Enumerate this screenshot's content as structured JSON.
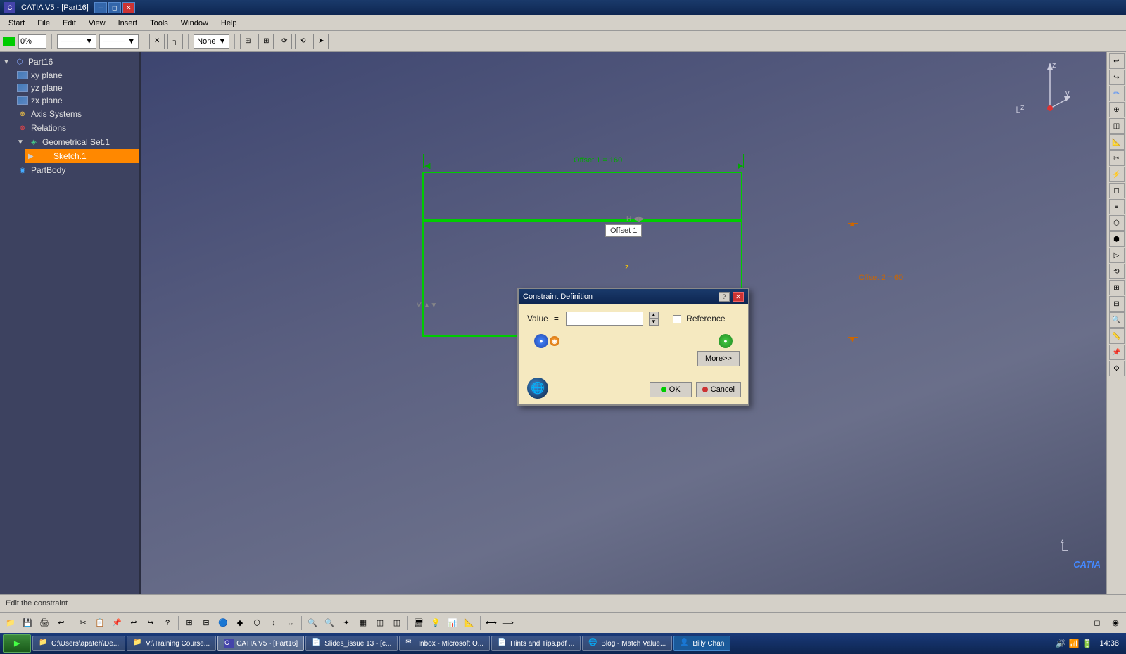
{
  "title_bar": {
    "title": "CATIA V5 - [Part16]",
    "icon": "C",
    "buttons": [
      "minimize",
      "restore",
      "close"
    ]
  },
  "menu_bar": {
    "items": [
      "Start",
      "File",
      "Edit",
      "View",
      "Insert",
      "Tools",
      "Window",
      "Help"
    ]
  },
  "toolbar": {
    "color_btn": "■",
    "percent": "0%",
    "line_style": "—",
    "line_weight": "—",
    "none_label": "None"
  },
  "left_panel": {
    "title": "Part16",
    "items": [
      {
        "id": "part16",
        "label": "Part16",
        "icon": "part",
        "indent": 0
      },
      {
        "id": "xy-plane",
        "label": "xy plane",
        "icon": "plane",
        "indent": 1
      },
      {
        "id": "yz-plane",
        "label": "yz plane",
        "icon": "plane",
        "indent": 1
      },
      {
        "id": "zx-plane",
        "label": "zx plane",
        "icon": "plane",
        "indent": 1
      },
      {
        "id": "axis-systems",
        "label": "Axis Systems",
        "icon": "axis",
        "indent": 1
      },
      {
        "id": "relations",
        "label": "Relations",
        "icon": "relations",
        "indent": 1
      },
      {
        "id": "geometrical-set",
        "label": "Geometrical Set.1",
        "icon": "geoset",
        "indent": 1,
        "underline": true
      },
      {
        "id": "sketch1",
        "label": "Sketch.1",
        "icon": "sketch",
        "indent": 2,
        "selected": true
      },
      {
        "id": "partbody",
        "label": "PartBody",
        "icon": "partbody",
        "indent": 1
      }
    ]
  },
  "canvas": {
    "offset1_label": "Offset 1 = 160",
    "offset1_box": "Offset 1",
    "offset2_label": "Offset.2 = 60",
    "axis_z": "z",
    "axis_y": "y",
    "axis_corner_z": "z",
    "axis_corner": "└"
  },
  "dialog": {
    "title": "Constraint Definition",
    "value_label": "Value",
    "value_input": "",
    "reference_label": "Reference",
    "more_btn": "More>>",
    "ok_btn": "OK",
    "cancel_btn": "Cancel"
  },
  "status_bar": {
    "message": "Edit the constraint"
  },
  "bottom_toolbar": {
    "icons": [
      "📁",
      "💾",
      "✂",
      "📋",
      "↩",
      "↪",
      "?",
      "⊞",
      "⊟",
      "🔵",
      "🔶",
      "⬡",
      "⬢",
      "↕",
      "↔",
      "🔍",
      "🔍",
      "✦",
      "▦",
      "◫",
      "◫",
      "🖥",
      "💡",
      "📊",
      "📐"
    ]
  },
  "taskbar": {
    "start_label": "▶",
    "items": [
      {
        "label": "C:\\Users\\apateh\\De...",
        "icon": "📁"
      },
      {
        "label": "V:\\Training Course...",
        "icon": "📁"
      },
      {
        "label": "CATIA V5 - [Part16]",
        "icon": "C",
        "active": true
      },
      {
        "label": "Slides_issue 13 - [c...",
        "icon": "📄"
      },
      {
        "label": "Inbox - Microsoft O...",
        "icon": "✉"
      },
      {
        "label": "Hints and Tips.pdf ...",
        "icon": "📄"
      },
      {
        "label": "Blog - Match Value...",
        "icon": "🌐"
      },
      {
        "label": "Billy Chan",
        "icon": "👤",
        "active": true
      }
    ],
    "clock": "14:38"
  }
}
